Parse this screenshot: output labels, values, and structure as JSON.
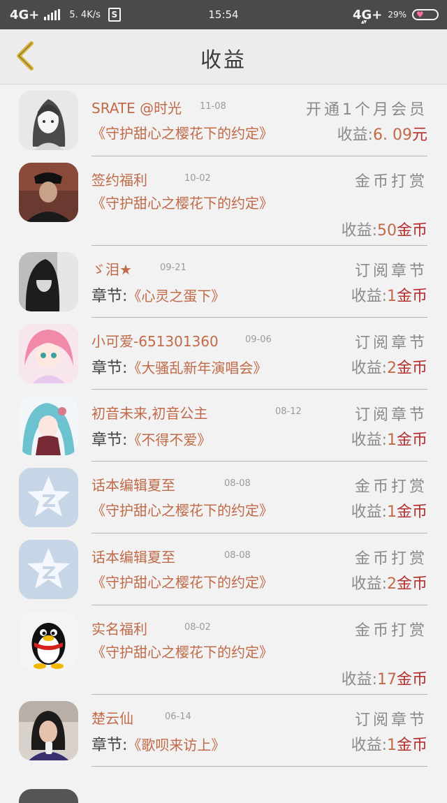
{
  "status_bar": {
    "network_left": "4G+",
    "speed": "5. 4K/s",
    "s_icon": "S",
    "time": "15:54",
    "network_right": "4G+",
    "battery_pct": "29%"
  },
  "header": {
    "title": "收益",
    "back_icon": "chevron-left-icon"
  },
  "rows": [
    {
      "name": "SRATE @时光",
      "date": "11-08",
      "type": "开通1个月会员",
      "line2": "《守护甜心之樱花下的约定》",
      "chapter_label": "",
      "earn_label": "收益:",
      "earn_value": "6. 09",
      "earn_unit": "元",
      "avatar": "anime-girl-sketch"
    },
    {
      "name": "签约福利",
      "date": "10-02",
      "type": "金币打赏",
      "line2": "《守护甜心之樱花下的约定》",
      "chapter_label": "",
      "earn_label": "收益:",
      "earn_value": "50",
      "earn_unit": "金币",
      "avatar": "photo-man-dark"
    },
    {
      "name": "ゞ泪★",
      "date": "09-21",
      "type": "订阅章节",
      "line2": "《心灵之蛋下》",
      "chapter_label": "章节:",
      "earn_label": "收益:",
      "earn_value": "1",
      "earn_unit": "金币",
      "avatar": "photo-girl-bw"
    },
    {
      "name": "小可爱-651301360",
      "date": "09-06",
      "type": "订阅章节",
      "line2": "《大骚乱新年演唱会》",
      "chapter_label": "章节:",
      "earn_label": "收益:",
      "earn_value": "2",
      "earn_unit": "金币",
      "avatar": "anime-pink"
    },
    {
      "name": "初音未来,初音公主",
      "date": "08-12",
      "type": "订阅章节",
      "line2": "《不得不爱》",
      "chapter_label": "章节:",
      "earn_label": "收益:",
      "earn_value": "1",
      "earn_unit": "金币",
      "avatar": "anime-miku"
    },
    {
      "name": "话本编辑夏至",
      "date": "08-08",
      "type": "金币打赏",
      "line2": "《守护甜心之樱花下的约定》",
      "chapter_label": "",
      "earn_label": "收益:",
      "earn_value": "1",
      "earn_unit": "金币",
      "avatar": "qzone-star"
    },
    {
      "name": "话本编辑夏至",
      "date": "08-08",
      "type": "金币打赏",
      "line2": "《守护甜心之樱花下的约定》",
      "chapter_label": "",
      "earn_label": "收益:",
      "earn_value": "2",
      "earn_unit": "金币",
      "avatar": "qzone-star"
    },
    {
      "name": "实名福利",
      "date": "08-02",
      "type": "金币打赏",
      "line2": "《守护甜心之樱花下的约定》",
      "chapter_label": "",
      "earn_label": "收益:",
      "earn_value": "17",
      "earn_unit": "金币",
      "avatar": "qq-penguin"
    },
    {
      "name": "楚云仙",
      "date": "06-14",
      "type": "订阅章节",
      "line2": "《歌呗来访上》",
      "chapter_label": "章节:",
      "earn_label": "收益:",
      "earn_value": "1",
      "earn_unit": "金币",
      "avatar": "photo-girl-glasses"
    }
  ]
}
